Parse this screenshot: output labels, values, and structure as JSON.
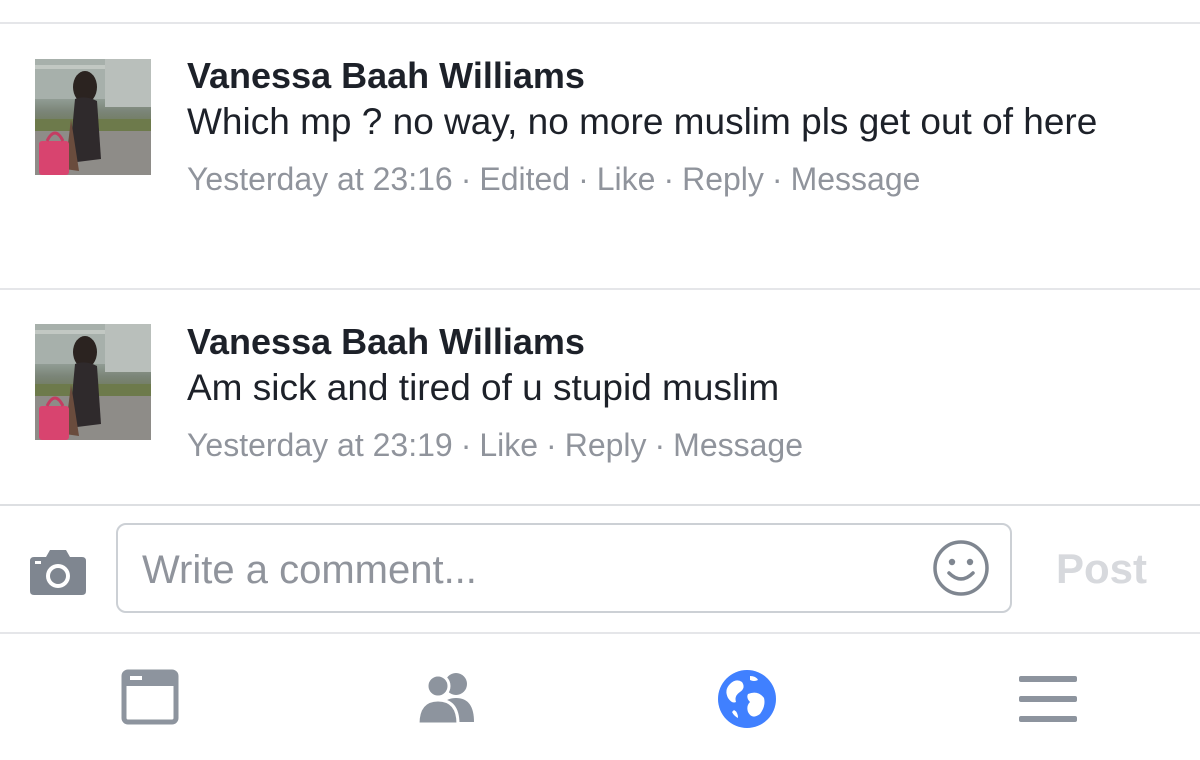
{
  "comments": [
    {
      "author": "Vanessa Baah Williams",
      "text": "Which mp ? no way, no more muslim pls get out of here",
      "timestamp": "Yesterday at 23:16",
      "edited": "Edited",
      "like": "Like",
      "reply": "Reply",
      "message": "Message"
    },
    {
      "author": "Vanessa Baah Williams",
      "text": "Am sick and tired of u stupid muslim",
      "timestamp": "Yesterday at 23:19",
      "like": "Like",
      "reply": "Reply",
      "message": "Message"
    }
  ],
  "composer": {
    "placeholder": "Write a comment...",
    "post_label": "Post",
    "camera_icon": "camera-icon",
    "emoji_icon": "smiley-icon"
  },
  "tabbar": {
    "tabs": [
      {
        "icon": "news-feed-icon"
      },
      {
        "icon": "friends-icon"
      },
      {
        "icon": "globe-icon",
        "active": true
      },
      {
        "icon": "menu-icon"
      }
    ]
  },
  "colors": {
    "text": "#1d2129",
    "meta": "#90949c",
    "divider": "#e5e6e9",
    "active_tab": "#4080ff",
    "inactive_tab": "#8d949e",
    "post_disabled": "#d7d9dd"
  }
}
